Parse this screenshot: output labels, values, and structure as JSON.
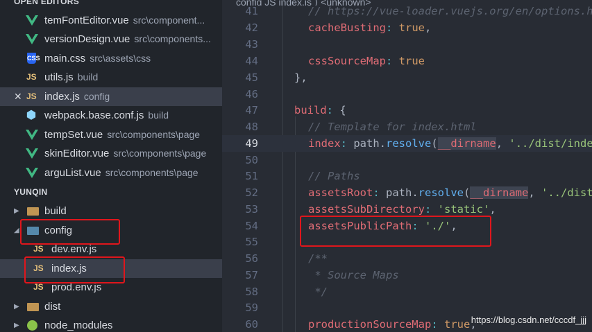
{
  "sidebar": {
    "open_editors_title": "OPEN EDITORS",
    "open_editors": [
      {
        "icon": "vue-icon",
        "name": "temFontEditor.vue",
        "desc": "src\\component..."
      },
      {
        "icon": "vue-icon",
        "name": "versionDesign.vue",
        "desc": "src\\components..."
      },
      {
        "icon": "css-icon",
        "name": "main.css",
        "desc": "src\\assets\\css"
      },
      {
        "icon": "js-icon",
        "name": "utils.js",
        "desc": "build"
      },
      {
        "icon": "js-icon",
        "name": "index.js",
        "desc": "config",
        "active": true,
        "close": "✕"
      },
      {
        "icon": "webpack-icon",
        "name": "webpack.base.conf.js",
        "desc": "build"
      },
      {
        "icon": "vue-icon",
        "name": "tempSet.vue",
        "desc": "src\\components\\page"
      },
      {
        "icon": "vue-icon",
        "name": "skinEditor.vue",
        "desc": "src\\components\\page"
      },
      {
        "icon": "vue-icon",
        "name": "arguList.vue",
        "desc": "src\\components\\page"
      }
    ],
    "project_title": "YUNQIN",
    "tree": [
      {
        "type": "folder",
        "name": "build",
        "expanded": false
      },
      {
        "type": "folder",
        "name": "config",
        "expanded": true
      },
      {
        "type": "file",
        "name": "dev.env.js"
      },
      {
        "type": "file",
        "name": "index.js",
        "active": true
      },
      {
        "type": "file",
        "name": "prod.env.js"
      },
      {
        "type": "folder",
        "name": "dist",
        "expanded": false
      },
      {
        "type": "folder",
        "name": "node_modules",
        "expanded": false
      }
    ],
    "js_badge": "JS",
    "css_badge": "CSS"
  },
  "editor": {
    "breadcrumb": "config  JS  index.js  ⟩  <unknown>",
    "active_line": 49,
    "lines": [
      {
        "n": "41",
        "t": "    // https://vue-loader.vuejs.org/en/options.html"
      },
      {
        "n": "42",
        "t": "    cacheBusting: true,"
      },
      {
        "n": "43",
        "t": ""
      },
      {
        "n": "44",
        "t": "    cssSourceMap: true"
      },
      {
        "n": "45",
        "t": "  },"
      },
      {
        "n": "46",
        "t": ""
      },
      {
        "n": "47",
        "t": "  build: {"
      },
      {
        "n": "48",
        "t": "    // Template for index.html"
      },
      {
        "n": "49",
        "t": "    index: path.resolve(__dirname, '../dist/index.html'),"
      },
      {
        "n": "50",
        "t": ""
      },
      {
        "n": "51",
        "t": "    // Paths"
      },
      {
        "n": "52",
        "t": "    assetsRoot: path.resolve(__dirname, '../dist'),"
      },
      {
        "n": "53",
        "t": "    assetsSubDirectory: 'static',"
      },
      {
        "n": "54",
        "t": "    assetsPublicPath: './',"
      },
      {
        "n": "55",
        "t": ""
      },
      {
        "n": "56",
        "t": "    /**"
      },
      {
        "n": "57",
        "t": "     * Source Maps"
      },
      {
        "n": "58",
        "t": "     */"
      },
      {
        "n": "59",
        "t": ""
      },
      {
        "n": "60",
        "t": "    productionSourceMap: true,"
      }
    ]
  },
  "watermark": "https://blog.csdn.net/cccdf_jjj",
  "colors": {
    "highlight_box": "#e0161c",
    "vue": "#41b883",
    "js": "#e5c07b"
  }
}
